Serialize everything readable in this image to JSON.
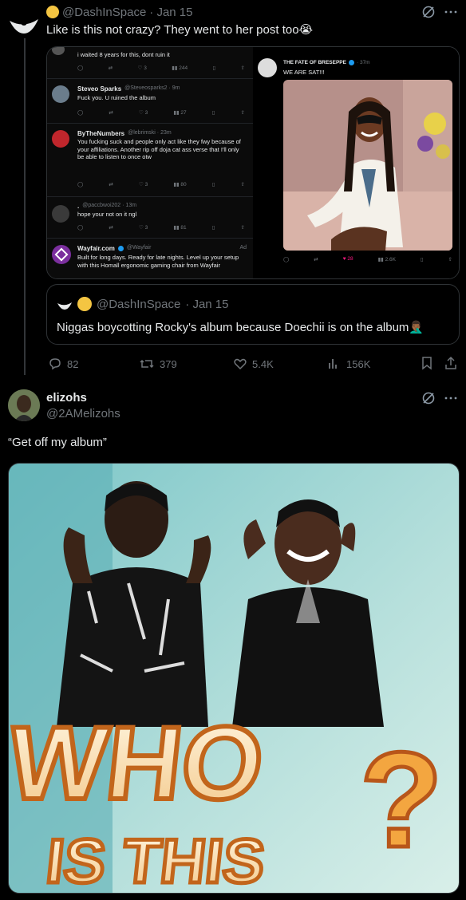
{
  "post": {
    "author_handle": "@DashInSpace",
    "date": "· Jan 15",
    "text": "Like is this not crazy? They went to her post too😭"
  },
  "embedded": {
    "tweets": [
      {
        "name": "",
        "handle": "",
        "text": "i waited 8 years for this, dont ruin it",
        "likes": "3",
        "views": "244"
      },
      {
        "name": "Steveo Sparks",
        "handle": "@Steveosparks2 · 9m",
        "text": "Fuck you. U ruined the album",
        "likes": "3",
        "views": "27"
      },
      {
        "name": "ByTheNumbers",
        "handle": "@lebrimski · 23m",
        "text": "You fucking suck and people only act like they fwy because of your affiliations. Another rip off doja cat ass verse that I'll only be able to listen to once otw",
        "likes": "3",
        "views": "80"
      },
      {
        "name": ".",
        "handle": "@paccbwoi202 · 13m",
        "text": "hope your not on it ngl",
        "likes": "3",
        "views": "81"
      },
      {
        "name": "Wayfair.com",
        "handle": "@Wayfair",
        "ad": "Ad",
        "text": "Built for long days. Ready for late nights. Level up your setup with this Homall ergonomic gaming chair from Wayfair"
      }
    ],
    "right": {
      "name": "THE FATE OF BRESEPPE",
      "time": "· 37m",
      "text": "WE ARE SAT!!!",
      "likes": "28",
      "views": "2.6K"
    }
  },
  "quote": {
    "author_handle": "@DashInSpace",
    "date": "· Jan 15",
    "text": "Niggas boycotting Rocky's album because  Doechii is on the album🤦🏾‍♂️"
  },
  "stats": {
    "replies": "82",
    "reposts": "379",
    "likes": "5.4K",
    "views": "156K"
  },
  "reply": {
    "name": "elizohs",
    "handle": "@2AMelizohs",
    "text": "“Get off my album”",
    "image_caption_top": "WHO",
    "image_caption_bottom": "IS THIS"
  },
  "colors": {
    "accent": "#1d9bf0",
    "like_pink": "#f91880",
    "muted": "#71767b",
    "border": "#2f3336"
  },
  "icons": [
    "grok-icon",
    "more-icon",
    "reply-icon",
    "repost-icon",
    "like-icon",
    "views-icon",
    "bookmark-icon",
    "share-icon"
  ]
}
